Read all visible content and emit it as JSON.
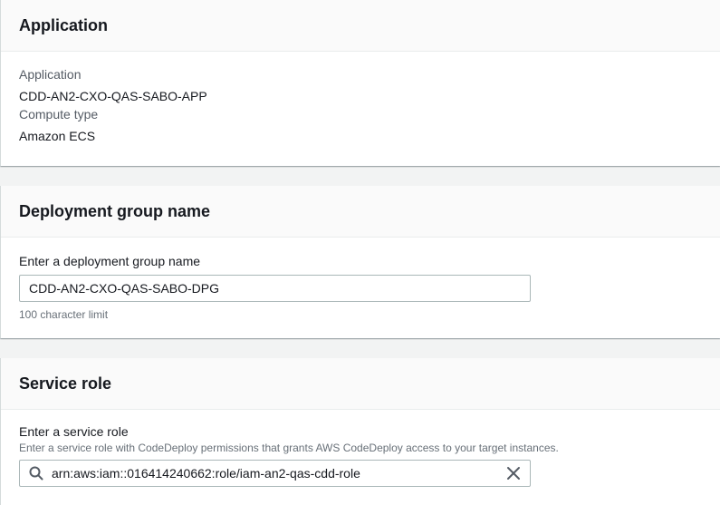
{
  "application_panel": {
    "title": "Application",
    "application_label": "Application",
    "application_value": "CDD-AN2-CXO-QAS-SABO-APP",
    "compute_type_label": "Compute type",
    "compute_type_value": "Amazon ECS"
  },
  "deployment_group_panel": {
    "title": "Deployment group name",
    "field_label": "Enter a deployment group name",
    "field_value": "CDD-AN2-CXO-QAS-SABO-DPG",
    "constraint_text": "100 character limit"
  },
  "service_role_panel": {
    "title": "Service role",
    "field_label": "Enter a service role",
    "field_description": "Enter a service role with CodeDeploy permissions that grants AWS CodeDeploy access to your target instances.",
    "field_value": "arn:aws:iam::016414240662:role/iam-an2-qas-cdd-role",
    "icons": {
      "search": "search-icon",
      "clear": "close-icon"
    }
  }
}
